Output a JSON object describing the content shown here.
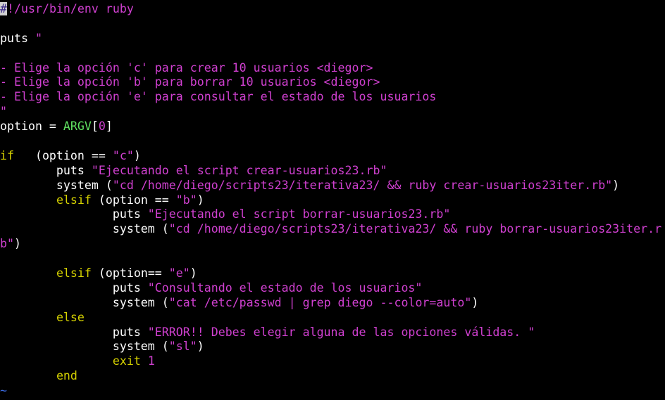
{
  "colors": {
    "background": "#000000",
    "default": "#ffffff",
    "keyword": "#d4d000",
    "string": "#d040d0",
    "constant": "#60e060",
    "tilde": "#3a6ae0",
    "cursor_bg": "#d0d0d0",
    "cursor_fg": "#3a2a8a"
  },
  "lines": [
    [
      {
        "t": "#",
        "c": "cursor"
      },
      {
        "t": "!/usr/bin/env ruby",
        "c": "string"
      }
    ],
    [],
    [
      {
        "t": "puts ",
        "c": "default"
      },
      {
        "t": "\"",
        "c": "string"
      }
    ],
    [],
    [
      {
        "t": "- Elige la opción 'c' para crear 10 usuarios <diegor>",
        "c": "string"
      }
    ],
    [
      {
        "t": "- Elige la opción 'b' para borrar 10 usuarios <diegor>",
        "c": "string"
      }
    ],
    [
      {
        "t": "- Elige la opción 'e' para consultar el estado de los usuarios",
        "c": "string"
      }
    ],
    [
      {
        "t": "\"",
        "c": "string"
      }
    ],
    [
      {
        "t": "option = ",
        "c": "default"
      },
      {
        "t": "ARGV",
        "c": "constant"
      },
      {
        "t": "[",
        "c": "default"
      },
      {
        "t": "0",
        "c": "string"
      },
      {
        "t": "]",
        "c": "default"
      }
    ],
    [],
    [
      {
        "t": "if",
        "c": "keyword"
      },
      {
        "t": "   (option == ",
        "c": "default"
      },
      {
        "t": "\"c\"",
        "c": "string"
      },
      {
        "t": ")",
        "c": "default"
      }
    ],
    [
      {
        "t": "        puts ",
        "c": "default"
      },
      {
        "t": "\"Ejecutando el script crear-usuarios23.rb\"",
        "c": "string"
      }
    ],
    [
      {
        "t": "        system (",
        "c": "default"
      },
      {
        "t": "\"cd /home/diego/scripts23/iterativa23/ && ruby crear-usuarios23iter.rb\"",
        "c": "string"
      },
      {
        "t": ")",
        "c": "default"
      }
    ],
    [
      {
        "t": "        ",
        "c": "default"
      },
      {
        "t": "elsif",
        "c": "keyword"
      },
      {
        "t": " (option == ",
        "c": "default"
      },
      {
        "t": "\"b\"",
        "c": "string"
      },
      {
        "t": ")",
        "c": "default"
      }
    ],
    [
      {
        "t": "                puts ",
        "c": "default"
      },
      {
        "t": "\"Ejecutando el script borrar-usuarios23.rb\"",
        "c": "string"
      }
    ],
    [
      {
        "t": "                system (",
        "c": "default"
      },
      {
        "t": "\"cd /home/diego/scripts23/iterativa23/ && ruby borrar-usuarios23iter.r",
        "c": "string"
      }
    ],
    [
      {
        "t": "b\"",
        "c": "string"
      },
      {
        "t": ")",
        "c": "default"
      }
    ],
    [],
    [
      {
        "t": "        ",
        "c": "default"
      },
      {
        "t": "elsif",
        "c": "keyword"
      },
      {
        "t": " (option== ",
        "c": "default"
      },
      {
        "t": "\"e\"",
        "c": "string"
      },
      {
        "t": ")",
        "c": "default"
      }
    ],
    [
      {
        "t": "                puts ",
        "c": "default"
      },
      {
        "t": "\"Consultando el estado de los usuarios\"",
        "c": "string"
      }
    ],
    [
      {
        "t": "                system (",
        "c": "default"
      },
      {
        "t": "\"cat /etc/passwd | grep diego --color=auto\"",
        "c": "string"
      },
      {
        "t": ")",
        "c": "default"
      }
    ],
    [
      {
        "t": "        ",
        "c": "default"
      },
      {
        "t": "else",
        "c": "keyword"
      }
    ],
    [
      {
        "t": "                puts ",
        "c": "default"
      },
      {
        "t": "\"ERROR!! Debes elegir alguna de las opciones válidas. \"",
        "c": "string"
      }
    ],
    [
      {
        "t": "                system (",
        "c": "default"
      },
      {
        "t": "\"sl\"",
        "c": "string"
      },
      {
        "t": ")",
        "c": "default"
      }
    ],
    [
      {
        "t": "                ",
        "c": "default"
      },
      {
        "t": "exit",
        "c": "keyword"
      },
      {
        "t": " ",
        "c": "default"
      },
      {
        "t": "1",
        "c": "string"
      }
    ],
    [
      {
        "t": "        ",
        "c": "default"
      },
      {
        "t": "end",
        "c": "keyword"
      }
    ],
    [
      {
        "t": "~",
        "c": "tilde"
      }
    ]
  ]
}
